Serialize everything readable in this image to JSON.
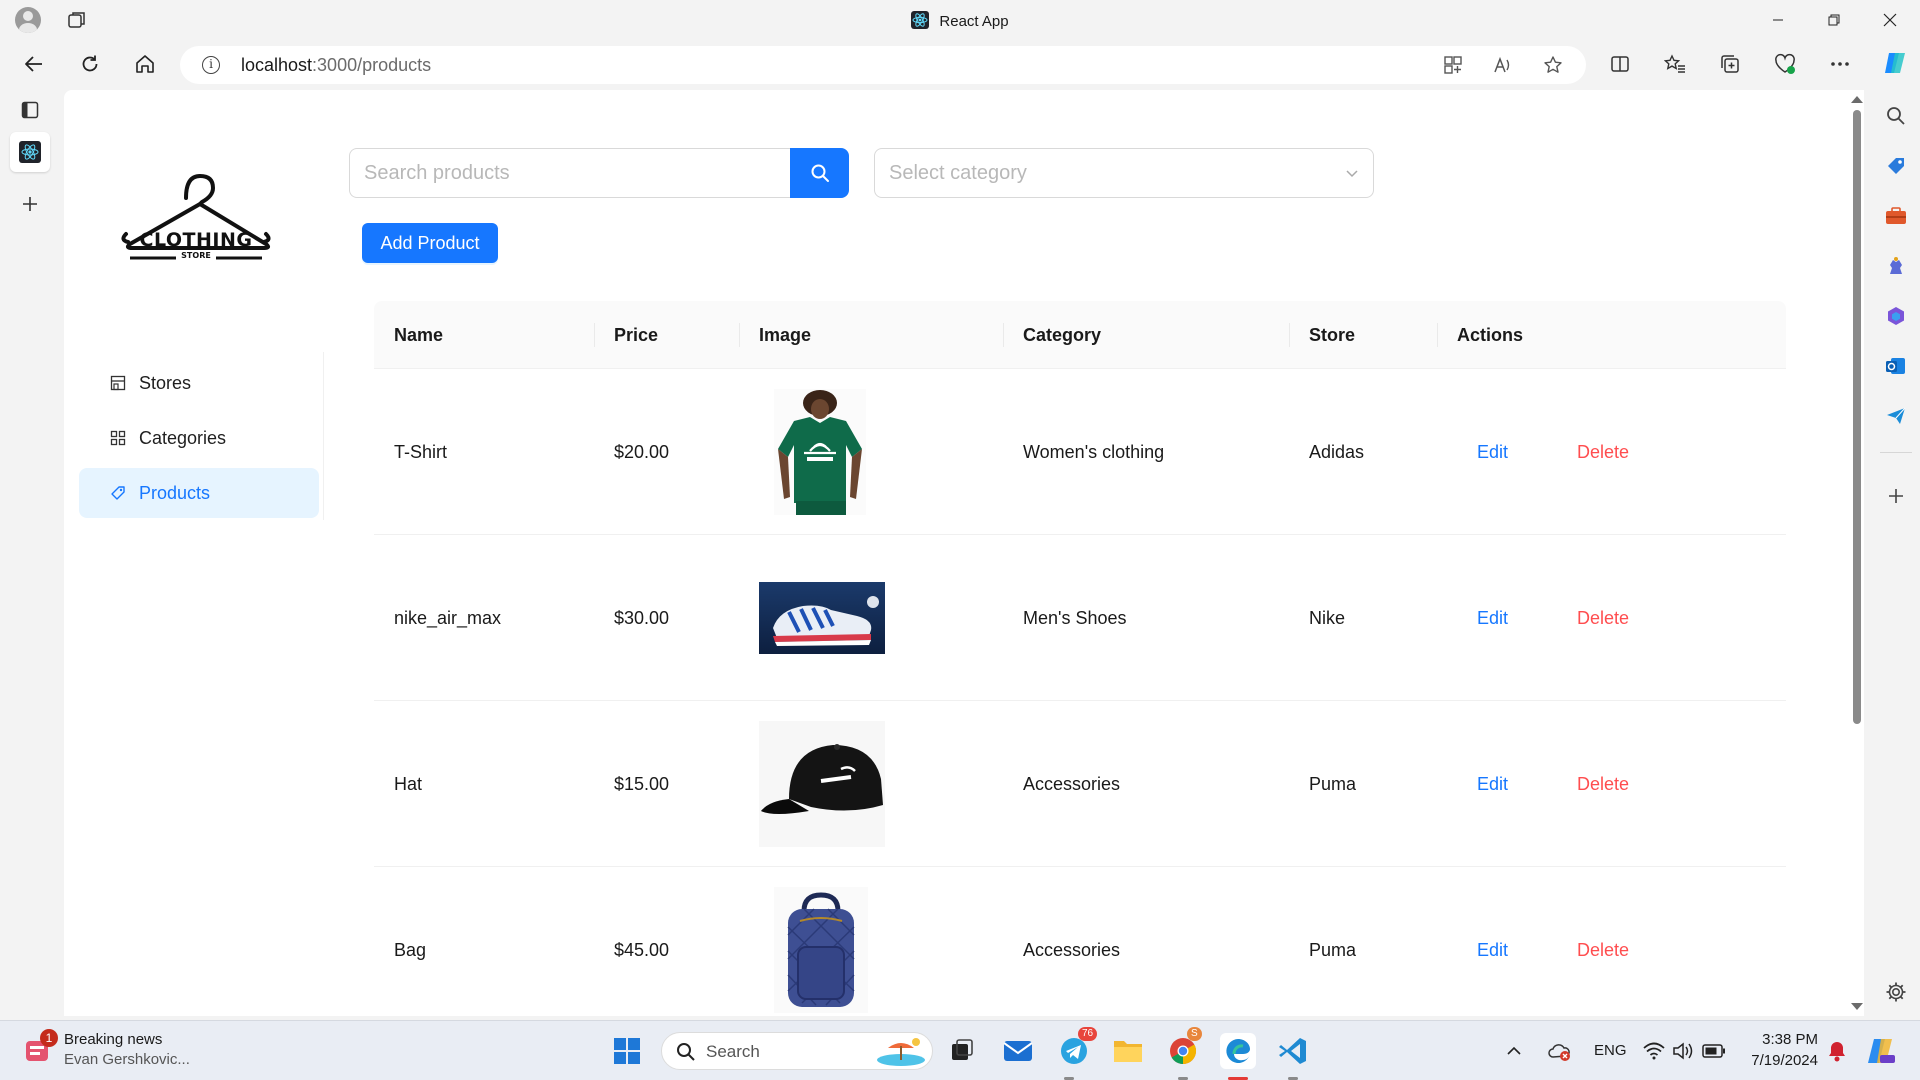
{
  "browser": {
    "window_title": "React App",
    "url_host": "localhost",
    "url_path": ":3000/products"
  },
  "app": {
    "logo_text": "CLOTHING",
    "logo_subtext": "STORE",
    "menu": [
      {
        "label": "Stores",
        "icon": "store-icon",
        "active": false
      },
      {
        "label": "Categories",
        "icon": "grid-icon",
        "active": false
      },
      {
        "label": "Products",
        "icon": "tag-icon",
        "active": true
      }
    ],
    "search_placeholder": "Search products",
    "category_placeholder": "Select category",
    "add_button_label": "Add Product",
    "table": {
      "headers": [
        "Name",
        "Price",
        "Image",
        "Category",
        "Store",
        "Actions"
      ],
      "rows": [
        {
          "name": "T-Shirt",
          "price": "$20.00",
          "image": "green-adidas-tshirt",
          "category": "Women's clothing",
          "store": "Adidas",
          "edit": "Edit",
          "delete": "Delete"
        },
        {
          "name": "nike_air_max",
          "price": "$30.00",
          "image": "blue-sneaker",
          "category": "Men's Shoes",
          "store": "Nike",
          "edit": "Edit",
          "delete": "Delete"
        },
        {
          "name": "Hat",
          "price": "$15.00",
          "image": "black-puma-cap",
          "category": "Accessories",
          "store": "Puma",
          "edit": "Edit",
          "delete": "Delete"
        },
        {
          "name": "Bag",
          "price": "$45.00",
          "image": "blue-backpack",
          "category": "Accessories",
          "store": "Puma",
          "edit": "Edit",
          "delete": "Delete"
        }
      ]
    }
  },
  "taskbar": {
    "news_badge": "1",
    "news_title": "Breaking news",
    "news_subtitle": "Evan Gershkovic...",
    "search_label": "Search",
    "telegram_badge": "76",
    "chrome_badge": "S",
    "language": "ENG",
    "time": "3:38 PM",
    "date": "7/19/2024"
  },
  "colors": {
    "accent": "#1677ff",
    "danger": "#ff4d4f",
    "menu_active_bg": "#e6f4ff"
  }
}
